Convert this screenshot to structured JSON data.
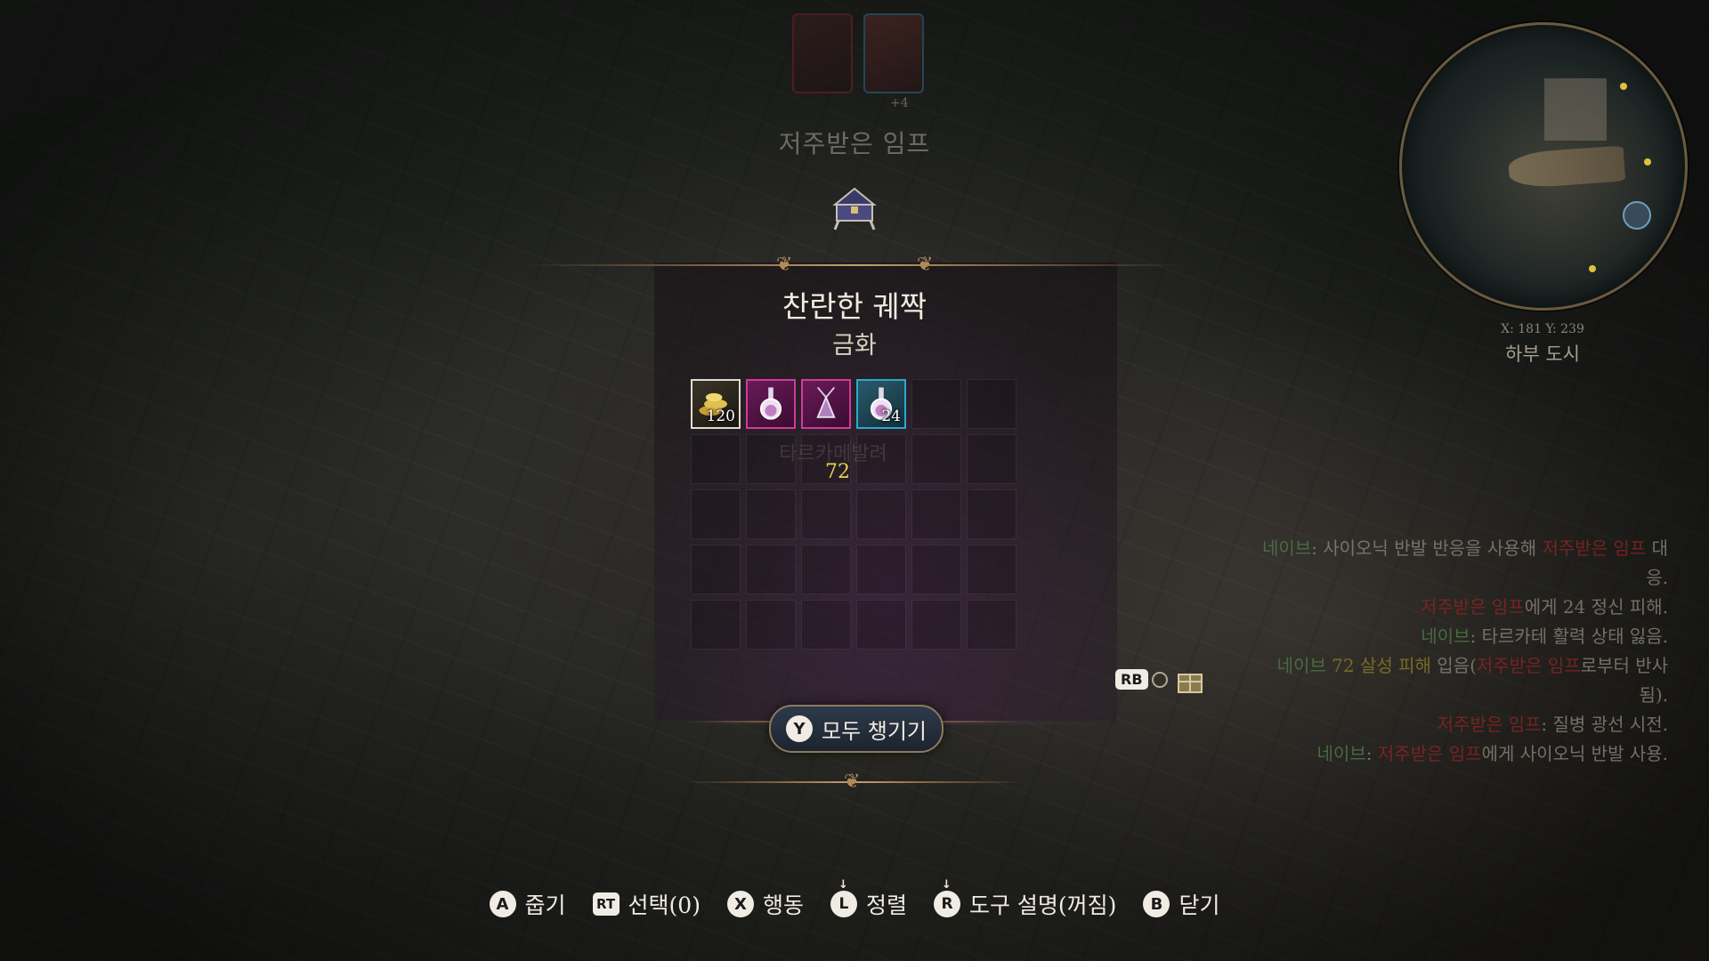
{
  "party": {
    "portraits": [
      {
        "name": "portrait-imp"
      },
      {
        "name": "portrait-character"
      }
    ],
    "extra_count": "+4"
  },
  "target": {
    "name": "저주받은 임프"
  },
  "container": {
    "title": "찬란한 궤짝",
    "subtitle": "금화",
    "hover_ghost": "타르카메발려",
    "hover_value": "72",
    "items": [
      {
        "slot": 0,
        "type": "gold",
        "quantity": "120",
        "icon": "gold-coins-icon"
      },
      {
        "slot": 1,
        "type": "rare",
        "quantity": "",
        "icon": "potion-icon"
      },
      {
        "slot": 2,
        "type": "rare",
        "quantity": "",
        "icon": "amulet-icon"
      },
      {
        "slot": 3,
        "type": "uncommon",
        "quantity": "24",
        "icon": "potion-icon"
      }
    ],
    "grid_columns": 6,
    "grid_rows": 5
  },
  "actions": {
    "loot_all": {
      "glyph": "Y",
      "label": "모두 챙기기"
    },
    "rb_toggle": {
      "glyph": "RB"
    }
  },
  "hints": [
    {
      "glyph": "A",
      "label": "줍기",
      "style": "round"
    },
    {
      "glyph": "RT",
      "label": "선택(0)",
      "style": "rect"
    },
    {
      "glyph": "X",
      "label": "행동",
      "style": "round"
    },
    {
      "glyph": "L",
      "label": "정렬",
      "style": "stick"
    },
    {
      "glyph": "R",
      "label": "도구 설명(꺼짐)",
      "style": "stick"
    },
    {
      "glyph": "B",
      "label": "닫기",
      "style": "round"
    }
  ],
  "minimap": {
    "coords": "X: 181 Y: 239",
    "region": "하부 도시"
  },
  "combat_log": [
    [
      {
        "t": "네이브",
        "c": "green"
      },
      {
        "t": ": 사이오닉 반발 반응을 사용해 ",
        "c": "plain"
      },
      {
        "t": "저주받은 임프",
        "c": "red"
      },
      {
        "t": " 대응.",
        "c": "plain"
      }
    ],
    [
      {
        "t": "저주받은 임프",
        "c": "red"
      },
      {
        "t": "에게 24 정신 피해.",
        "c": "plain"
      }
    ],
    [
      {
        "t": "네이브",
        "c": "green"
      },
      {
        "t": ": 타르카테 활력 상태 잃음.",
        "c": "plain"
      }
    ],
    [
      {
        "t": "네이브 ",
        "c": "green"
      },
      {
        "t": "72 살성 피해",
        "c": "yellow"
      },
      {
        "t": " 입음(",
        "c": "plain"
      },
      {
        "t": "저주받은 임프",
        "c": "red"
      },
      {
        "t": "로부터 반사됨).",
        "c": "plain"
      }
    ],
    [
      {
        "t": "저주받은 임프",
        "c": "red"
      },
      {
        "t": ": 질병 광선 시전.",
        "c": "plain"
      }
    ],
    [
      {
        "t": "네이브",
        "c": "green"
      },
      {
        "t": ": ",
        "c": "plain"
      },
      {
        "t": "저주받은 임프",
        "c": "red"
      },
      {
        "t": "에게 사이오닉 반발 사용.",
        "c": "plain"
      }
    ]
  ],
  "colors": {
    "gold_border": "#e0dcd4",
    "rare_border": "#d23a9a",
    "uncommon_border": "#2aa8d0",
    "accent_gold": "#c4a070"
  }
}
